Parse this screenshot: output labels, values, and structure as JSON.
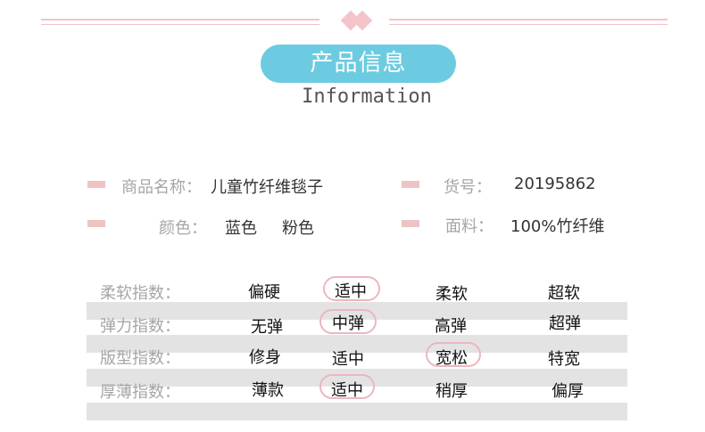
{
  "header": {
    "title": "产品信息",
    "subtitle": "Information"
  },
  "info": {
    "name_label": "商品名称：",
    "name_value": "儿童竹纤维毯子",
    "sku_label": "货号：",
    "sku_value": "20195862",
    "color_label": "颜色：",
    "color_values": [
      "蓝色",
      "粉色"
    ],
    "material_label": "面料：",
    "material_value": "100%竹纤维"
  },
  "table": {
    "rows": [
      {
        "label": "柔软指数：",
        "options": [
          "偏硬",
          "适中",
          "柔软",
          "超软"
        ],
        "selected": 1
      },
      {
        "label": "弹力指数：",
        "options": [
          "无弹",
          "中弹",
          "高弹",
          "超弹"
        ],
        "selected": 1
      },
      {
        "label": "版型指数：",
        "options": [
          "修身",
          "适中",
          "宽松",
          "特宽"
        ],
        "selected": 2
      },
      {
        "label": "厚薄指数：",
        "options": [
          "薄款",
          "适中",
          "稍厚",
          "偏厚"
        ],
        "selected": 1
      }
    ]
  },
  "colors": {
    "accent_blue": "#6ccbe0",
    "accent_pink": "#edc4c3",
    "stripe_gray": "#e3e3e3"
  }
}
